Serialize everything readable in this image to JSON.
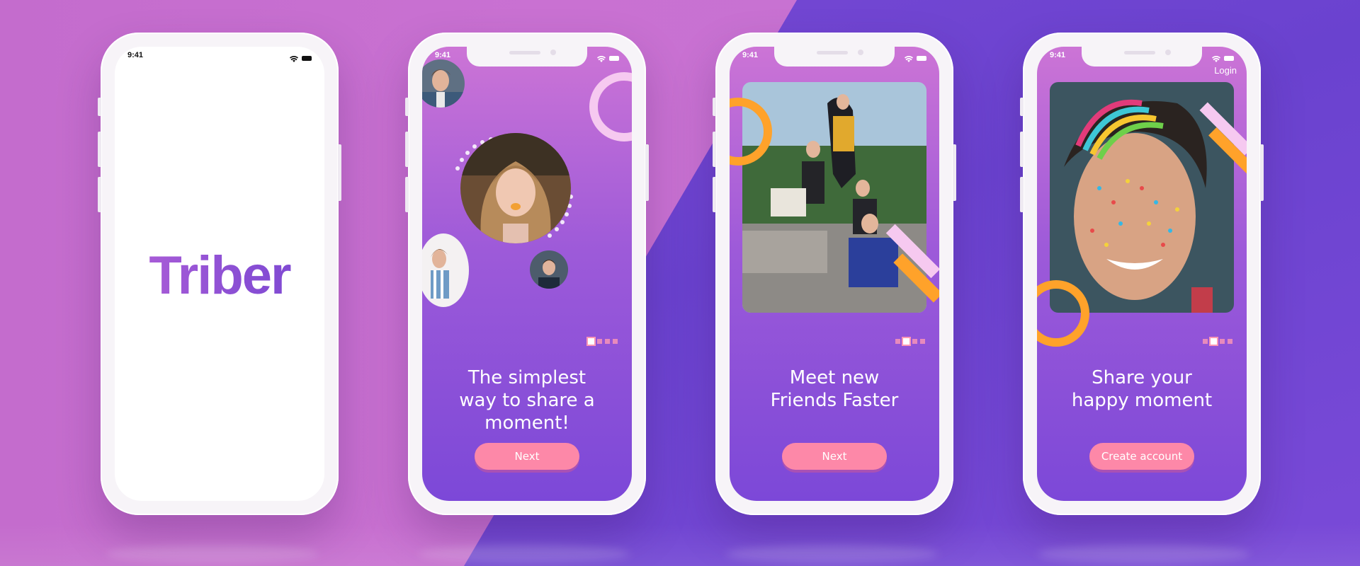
{
  "phones": [
    {
      "status": {
        "time": "9:41"
      },
      "logo": "Triber"
    },
    {
      "status": {
        "time": "9:41"
      },
      "caption": [
        "The simplest",
        "way to share a",
        "moment!"
      ],
      "button": "Next",
      "pagination": {
        "total": 4,
        "active": 1
      }
    },
    {
      "status": {
        "time": "9:41"
      },
      "caption": [
        "Meet new",
        "Friends Faster"
      ],
      "button": "Next",
      "pagination": {
        "total": 4,
        "active": 2
      }
    },
    {
      "status": {
        "time": "9:41"
      },
      "login": "Login",
      "caption": [
        "Share your",
        "happy moment"
      ],
      "button": "Create account",
      "pagination": {
        "total": 4,
        "active": 2
      }
    }
  ],
  "icons": [
    "wifi-icon",
    "battery-icon"
  ],
  "colors": {
    "accent": "#fd88a8",
    "orange": "#ffa22a",
    "light_pink": "#f6c9f0",
    "gradient_top": "#cc74d6",
    "gradient_bottom": "#7c48d8"
  }
}
